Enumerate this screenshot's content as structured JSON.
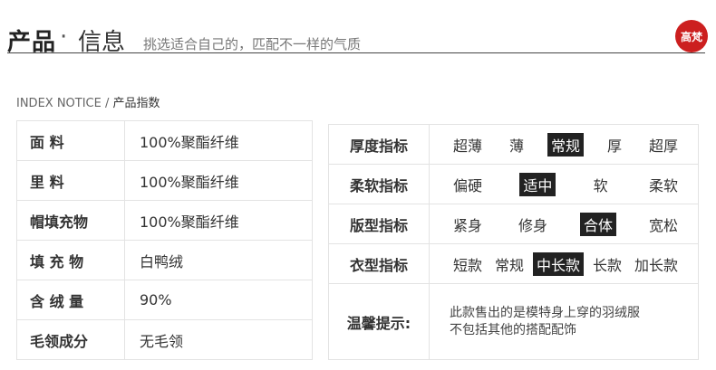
{
  "header": {
    "title": "产品",
    "dot": "·",
    "subtitle": "信息",
    "slogan": "挑选适合自己的，匹配不一样的气质",
    "logo": "高梵"
  },
  "section": {
    "en": "INDEX NOTICE /",
    "cn": "产品指数"
  },
  "specs": [
    {
      "label": "面    料",
      "value": "100%聚酯纤维"
    },
    {
      "label": "里    料",
      "value": "100%聚酯纤维"
    },
    {
      "label": "帽填充物",
      "value": "100%聚酯纤维"
    },
    {
      "label": "填 充 物",
      "value": "白鸭绒"
    },
    {
      "label": "含 绒 量",
      "value": "90%"
    },
    {
      "label": "毛领成分",
      "value": "无毛领"
    }
  ],
  "indices": [
    {
      "label": "厚度指标",
      "options": [
        "超薄",
        "薄",
        "常规",
        "厚",
        "超厚"
      ],
      "selected": 2
    },
    {
      "label": "柔软指标",
      "options": [
        "偏硬",
        "适中",
        "软",
        "柔软"
      ],
      "selected": 1
    },
    {
      "label": "版型指标",
      "options": [
        "紧身",
        "修身",
        "合体",
        "宽松"
      ],
      "selected": 2
    },
    {
      "label": "衣型指标",
      "options": [
        "短款",
        "常规",
        "中长款",
        "长款",
        "加长款"
      ],
      "selected": 2
    }
  ],
  "tip": {
    "label": "温馨提示:",
    "line1": "此款售出的是模特身上穿的羽绒服",
    "line2": "不包括其他的搭配配饰"
  }
}
